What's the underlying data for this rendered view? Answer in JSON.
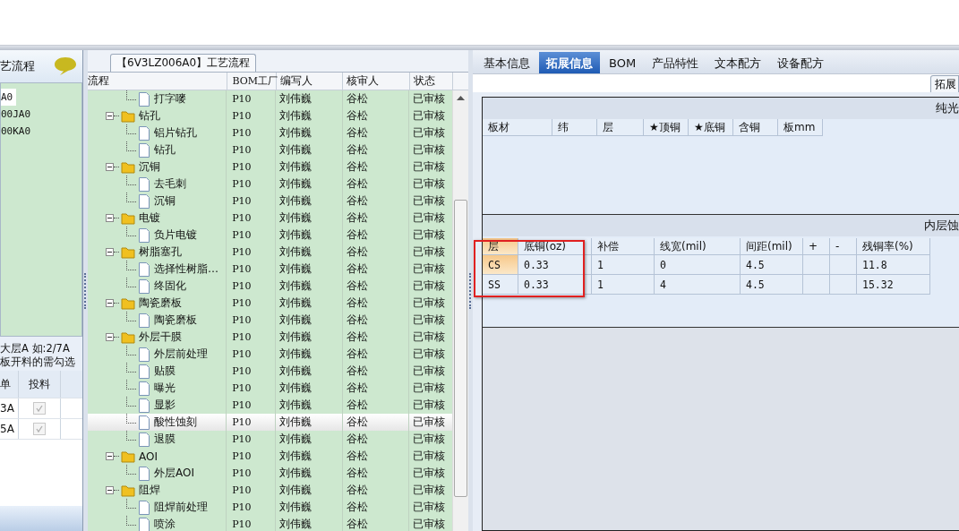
{
  "left_panel": {
    "title": "艺流程",
    "items": [
      {
        "label": "A0",
        "selected": true
      },
      {
        "label": "00JA0",
        "selected": false
      },
      {
        "label": "00KA0",
        "selected": false
      }
    ],
    "note_lines": [
      "大层A 如:2/7A",
      "板开料的需勾选"
    ],
    "table": {
      "columns": [
        "单",
        "投料"
      ],
      "rows": [
        {
          "label": "3A",
          "checked": true
        },
        {
          "label": "5A",
          "checked": true
        }
      ]
    }
  },
  "process_panel": {
    "tab": "【6V3LZ006A0】工艺流程",
    "columns": [
      "流程",
      "BOM工厂",
      "编写人",
      "核审人",
      "状态"
    ],
    "tree": [
      {
        "kind": "leaf",
        "label": "打字嘜",
        "bom": "P10",
        "writer": "刘伟巍",
        "reviewer": "谷松",
        "status": "已审核",
        "selected": false
      },
      {
        "kind": "folder",
        "label": "钻孔",
        "bom": "P10",
        "writer": "刘伟巍",
        "reviewer": "谷松",
        "status": "已审核",
        "selected": false,
        "expanded": true,
        "children": [
          {
            "kind": "leaf",
            "label": "铝片钻孔",
            "bom": "P10",
            "writer": "刘伟巍",
            "reviewer": "谷松",
            "status": "已审核",
            "selected": false
          },
          {
            "kind": "leaf",
            "label": "钻孔",
            "bom": "P10",
            "writer": "刘伟巍",
            "reviewer": "谷松",
            "status": "已审核",
            "selected": false
          }
        ]
      },
      {
        "kind": "folder",
        "label": "沉铜",
        "bom": "P10",
        "writer": "刘伟巍",
        "reviewer": "谷松",
        "status": "已审核",
        "selected": false,
        "expanded": true,
        "children": [
          {
            "kind": "leaf",
            "label": "去毛刺",
            "bom": "P10",
            "writer": "刘伟巍",
            "reviewer": "谷松",
            "status": "已审核",
            "selected": false
          },
          {
            "kind": "leaf",
            "label": "沉铜",
            "bom": "P10",
            "writer": "刘伟巍",
            "reviewer": "谷松",
            "status": "已审核",
            "selected": false
          }
        ]
      },
      {
        "kind": "folder",
        "label": "电镀",
        "bom": "P10",
        "writer": "刘伟巍",
        "reviewer": "谷松",
        "status": "已审核",
        "selected": false,
        "expanded": true,
        "children": [
          {
            "kind": "leaf",
            "label": "负片电镀",
            "bom": "P10",
            "writer": "刘伟巍",
            "reviewer": "谷松",
            "status": "已审核",
            "selected": false
          }
        ]
      },
      {
        "kind": "folder",
        "label": "树脂塞孔",
        "bom": "P10",
        "writer": "刘伟巍",
        "reviewer": "谷松",
        "status": "已审核",
        "selected": false,
        "expanded": true,
        "children": [
          {
            "kind": "leaf",
            "label": "选择性树脂…",
            "bom": "P10",
            "writer": "刘伟巍",
            "reviewer": "谷松",
            "status": "已审核",
            "selected": false
          },
          {
            "kind": "leaf",
            "label": "终固化",
            "bom": "P10",
            "writer": "刘伟巍",
            "reviewer": "谷松",
            "status": "已审核",
            "selected": false
          }
        ]
      },
      {
        "kind": "folder",
        "label": "陶瓷磨板",
        "bom": "P10",
        "writer": "刘伟巍",
        "reviewer": "谷松",
        "status": "已审核",
        "selected": false,
        "expanded": true,
        "children": [
          {
            "kind": "leaf",
            "label": "陶瓷磨板",
            "bom": "P10",
            "writer": "刘伟巍",
            "reviewer": "谷松",
            "status": "已审核",
            "selected": false
          }
        ]
      },
      {
        "kind": "folder",
        "label": "外层干膜",
        "bom": "P10",
        "writer": "刘伟巍",
        "reviewer": "谷松",
        "status": "已审核",
        "selected": false,
        "expanded": true,
        "children": [
          {
            "kind": "leaf",
            "label": "外层前处理",
            "bom": "P10",
            "writer": "刘伟巍",
            "reviewer": "谷松",
            "status": "已审核",
            "selected": false
          },
          {
            "kind": "leaf",
            "label": "贴膜",
            "bom": "P10",
            "writer": "刘伟巍",
            "reviewer": "谷松",
            "status": "已审核",
            "selected": false
          },
          {
            "kind": "leaf",
            "label": "曝光",
            "bom": "P10",
            "writer": "刘伟巍",
            "reviewer": "谷松",
            "status": "已审核",
            "selected": false
          },
          {
            "kind": "leaf",
            "label": "显影",
            "bom": "P10",
            "writer": "刘伟巍",
            "reviewer": "谷松",
            "status": "已审核",
            "selected": false
          },
          {
            "kind": "leaf",
            "label": "酸性蚀刻",
            "bom": "P10",
            "writer": "刘伟巍",
            "reviewer": "谷松",
            "status": "已审核",
            "selected": true
          },
          {
            "kind": "leaf",
            "label": "退膜",
            "bom": "P10",
            "writer": "刘伟巍",
            "reviewer": "谷松",
            "status": "已审核",
            "selected": false
          }
        ]
      },
      {
        "kind": "folder",
        "label": "AOI",
        "bom": "P10",
        "writer": "刘伟巍",
        "reviewer": "谷松",
        "status": "已审核",
        "selected": false,
        "expanded": true,
        "children": [
          {
            "kind": "leaf",
            "label": "外层AOI",
            "bom": "P10",
            "writer": "刘伟巍",
            "reviewer": "谷松",
            "status": "已审核",
            "selected": false
          }
        ]
      },
      {
        "kind": "folder",
        "label": "阻焊",
        "bom": "P10",
        "writer": "刘伟巍",
        "reviewer": "谷松",
        "status": "已审核",
        "selected": false,
        "expanded": true,
        "children": [
          {
            "kind": "leaf",
            "label": "阻焊前处理",
            "bom": "P10",
            "writer": "刘伟巍",
            "reviewer": "谷松",
            "status": "已审核",
            "selected": false
          },
          {
            "kind": "leaf",
            "label": "喷涂",
            "bom": "P10",
            "writer": "刘伟巍",
            "reviewer": "谷松",
            "status": "已审核",
            "selected": false
          }
        ]
      }
    ]
  },
  "detail_panel": {
    "tabs": [
      {
        "label": "基本信息",
        "selected": false
      },
      {
        "label": "拓展信息",
        "selected": true
      },
      {
        "label": "BOM",
        "selected": false
      },
      {
        "label": "产品特性",
        "selected": false
      },
      {
        "label": "文本配方",
        "selected": false
      },
      {
        "label": "设备配方",
        "selected": false
      }
    ],
    "button": "拓展",
    "section_1": {
      "title": "纯光",
      "columns": [
        "板材",
        "纬",
        "层",
        "★顶铜",
        "★底铜",
        "含铜",
        "板mm"
      ]
    },
    "section_2": {
      "title": "内层蚀",
      "columns": [
        "层",
        "底铜(oz)",
        "补偿",
        "线宽(mil)",
        "间距(mil)",
        "+",
        "-",
        "残铜率(%)"
      ],
      "rows": [
        [
          "CS",
          "0.33",
          "1",
          "0",
          "4.5",
          "",
          "",
          "11.8"
        ],
        [
          "SS",
          "0.33",
          "1",
          "4",
          "4.5",
          "",
          "",
          "15.32"
        ]
      ]
    }
  }
}
